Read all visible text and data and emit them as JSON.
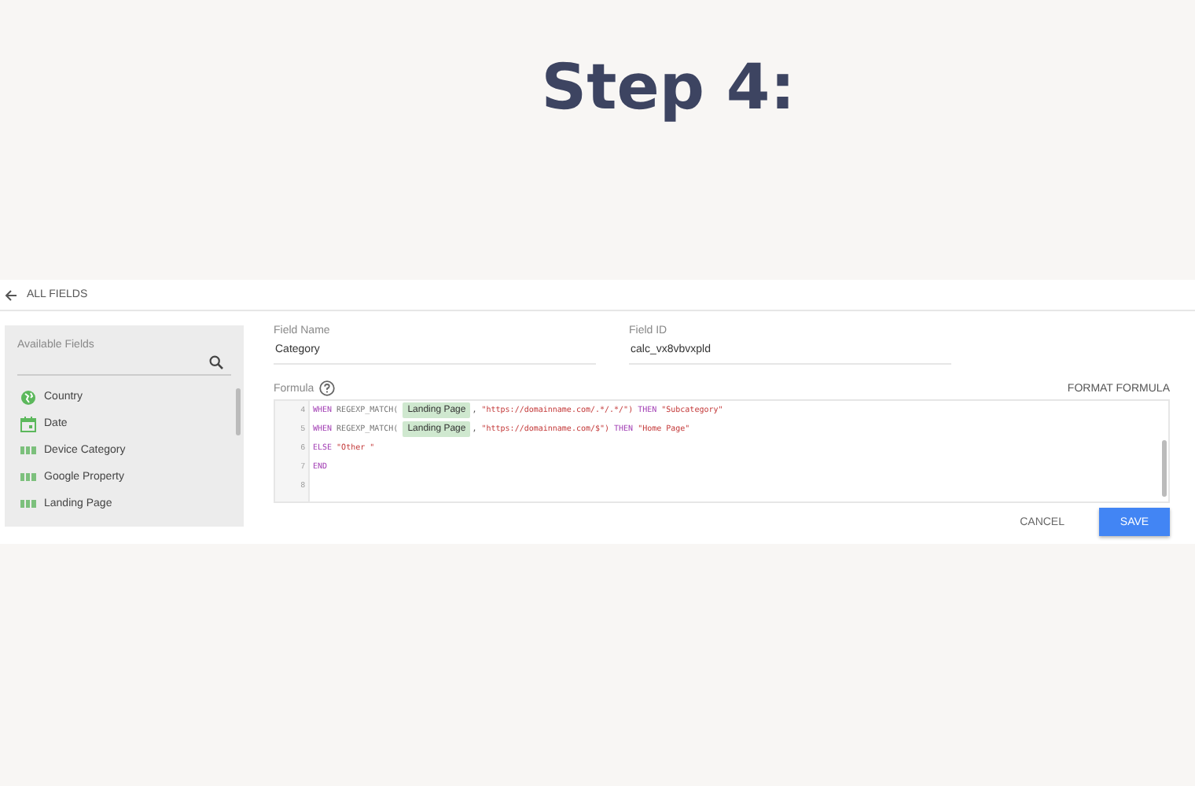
{
  "heading": "Step 4:",
  "back_link": "ALL FIELDS",
  "available_fields": {
    "label": "Available Fields",
    "items": [
      {
        "name": "Country",
        "kind": "geo"
      },
      {
        "name": "Date",
        "kind": "date"
      },
      {
        "name": "Device Category",
        "kind": "text"
      },
      {
        "name": "Google Property",
        "kind": "text"
      },
      {
        "name": "Landing Page",
        "kind": "text"
      }
    ]
  },
  "field_name": {
    "label": "Field Name",
    "value": "Category"
  },
  "field_id": {
    "label": "Field ID",
    "value": "calc_vx8vbvxpld"
  },
  "formula": {
    "label": "Formula",
    "format_button": "FORMAT FORMULA",
    "lines": [
      {
        "number": "4",
        "tokens": [
          {
            "kind": "keyword",
            "text": "WHEN"
          },
          {
            "kind": "func",
            "text": "REGEXP_MATCH("
          },
          {
            "kind": "chip",
            "text": "Landing Page"
          },
          {
            "kind": "plain",
            "text": ","
          },
          {
            "kind": "string",
            "text": "\"https://domainname.com/.*/.*/\")"
          },
          {
            "kind": "keyword",
            "text": "THEN"
          },
          {
            "kind": "string",
            "text": "\"Subcategory\""
          }
        ]
      },
      {
        "number": "5",
        "tokens": [
          {
            "kind": "keyword",
            "text": "WHEN"
          },
          {
            "kind": "func",
            "text": "REGEXP_MATCH("
          },
          {
            "kind": "chip",
            "text": "Landing Page"
          },
          {
            "kind": "plain",
            "text": ","
          },
          {
            "kind": "string",
            "text": "\"https://domainname.com/$\")"
          },
          {
            "kind": "keyword",
            "text": "THEN"
          },
          {
            "kind": "string",
            "text": "\"Home Page\""
          }
        ]
      },
      {
        "number": "6",
        "tokens": [
          {
            "kind": "keyword",
            "text": "ELSE"
          },
          {
            "kind": "string",
            "text": "\"Other \""
          }
        ]
      },
      {
        "number": "7",
        "tokens": [
          {
            "kind": "keyword",
            "text": "END"
          }
        ]
      },
      {
        "number": "8"
      }
    ]
  },
  "buttons": [
    {
      "label": "CANCEL",
      "kind": "flat"
    },
    {
      "label": "SAVE",
      "kind": "primary"
    }
  ]
}
